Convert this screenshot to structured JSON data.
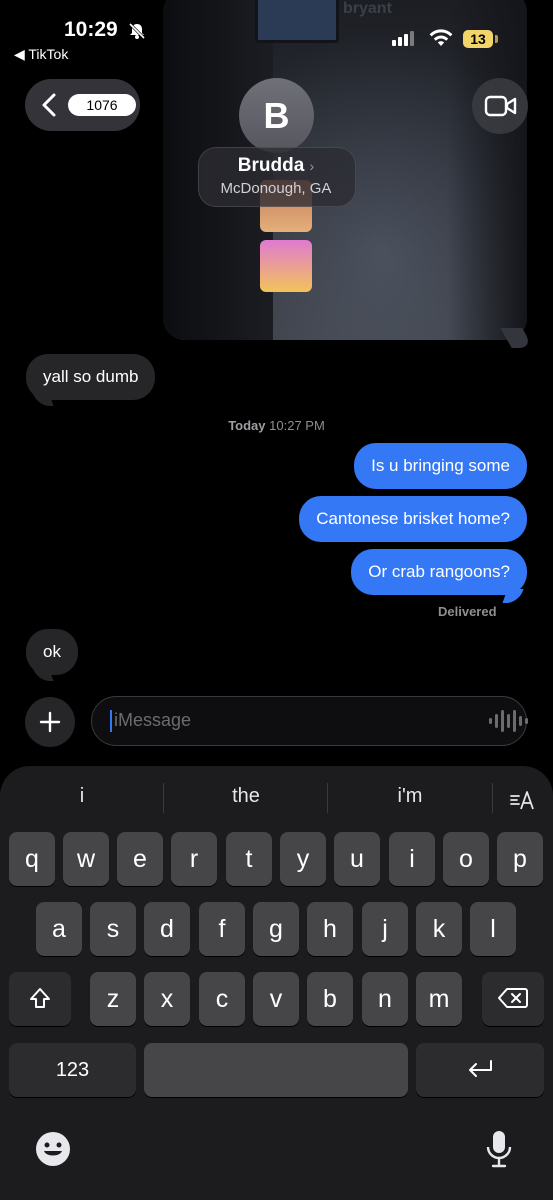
{
  "status_bar": {
    "time": "10:29",
    "back_app": "◀ TikTok",
    "battery": "13"
  },
  "header": {
    "unread_count": "1076",
    "avatar_initial": "B",
    "contact_name": "Brudda",
    "location": "McDonough, GA"
  },
  "media": {
    "overlay_text": "bryant"
  },
  "messages": {
    "received_1": "yall so dumb",
    "timestamp_day": "Today",
    "timestamp_time": "10:27 PM",
    "sent": [
      "Is u bringing some",
      "Cantonese brisket home?",
      "Or crab rangoons?"
    ],
    "delivered_label": "Delivered",
    "received_2": "ok"
  },
  "composer": {
    "placeholder": "iMessage"
  },
  "keyboard": {
    "suggestions": [
      "i",
      "the",
      "i'm"
    ],
    "row1": [
      "q",
      "w",
      "e",
      "r",
      "t",
      "y",
      "u",
      "i",
      "o",
      "p"
    ],
    "row2": [
      "a",
      "s",
      "d",
      "f",
      "g",
      "h",
      "j",
      "k",
      "l"
    ],
    "row3": [
      "z",
      "x",
      "c",
      "v",
      "b",
      "n",
      "m"
    ],
    "numbers_key": "123"
  },
  "colors": {
    "sent_bubble": "#3478f6",
    "received_bubble": "#262629",
    "battery": "#f3d46a"
  }
}
